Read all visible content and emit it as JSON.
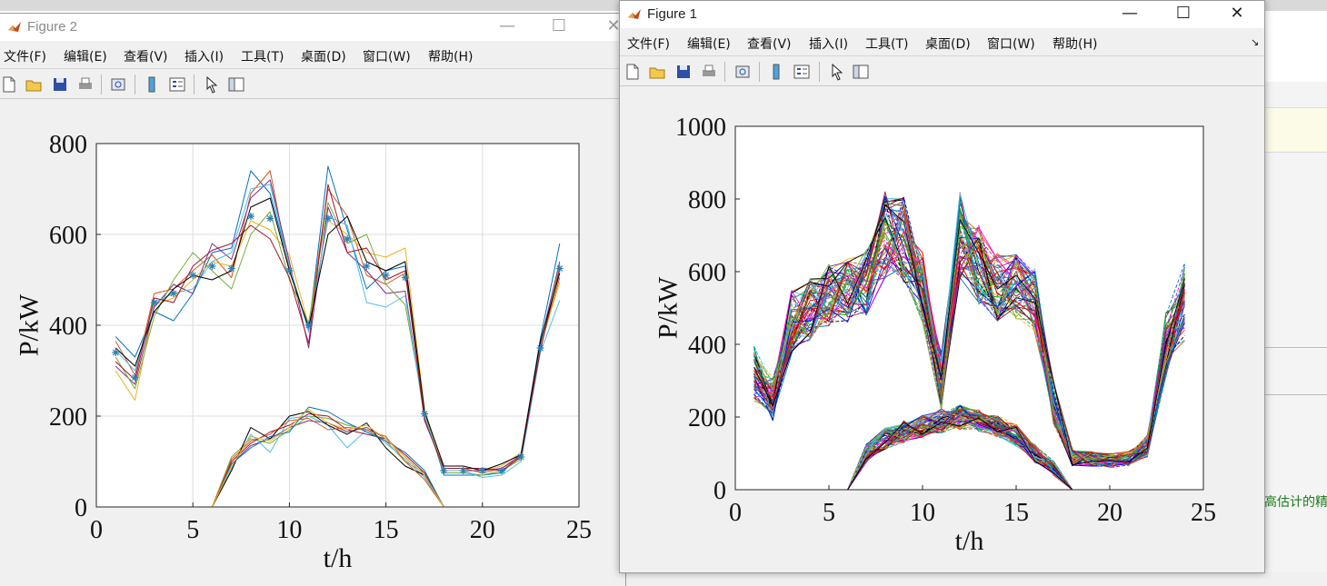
{
  "colors": {
    "series": [
      "#0072BD",
      "#D95319",
      "#EDB120",
      "#7E2F8E",
      "#77AC30",
      "#4DBEEE",
      "#A2142F",
      "#000000"
    ],
    "axes_bg": "#ffffff",
    "figure_bg": "#f0f0f0",
    "grid": "#dcdcdc"
  },
  "background": {
    "snippet": "高估计的精"
  },
  "windows": {
    "figure2": {
      "title": "Figure 2",
      "controls": {
        "minimize": "—",
        "maximize": "☐",
        "close": "✕"
      },
      "menu": [
        "文件(F)",
        "编辑(E)",
        "查看(V)",
        "插入(I)",
        "工具(T)",
        "桌面(D)",
        "窗口(W)",
        "帮助(H)"
      ],
      "toolbar_icons": [
        "new-file-icon",
        "open-folder-icon",
        "save-icon",
        "print-icon",
        "print-preview-icon",
        "colorbar-icon",
        "legend-icon",
        "pointer-icon",
        "property-inspector-icon"
      ]
    },
    "figure1": {
      "title": "Figure 1",
      "controls": {
        "minimize": "—",
        "maximize": "☐",
        "close": "✕",
        "dock": "↘"
      },
      "menu": [
        "文件(F)",
        "编辑(E)",
        "查看(V)",
        "插入(I)",
        "工具(T)",
        "桌面(D)",
        "窗口(W)",
        "帮助(H)"
      ],
      "toolbar_icons": [
        "new-file-icon",
        "open-folder-icon",
        "save-icon",
        "print-icon",
        "print-preview-icon",
        "colorbar-icon",
        "legend-icon",
        "pointer-icon",
        "property-inspector-icon"
      ]
    }
  },
  "chart_data": [
    {
      "figure": "Figure 2",
      "type": "line",
      "xlabel": "t/h",
      "ylabel": "P/kW",
      "xlim": [
        0,
        25
      ],
      "ylim": [
        0,
        800
      ],
      "xticks": [
        "0",
        "5",
        "10",
        "15",
        "20",
        "25"
      ],
      "yticks": [
        "0",
        "200",
        "400",
        "600",
        "800"
      ],
      "grid": true,
      "x": [
        1,
        2,
        3,
        4,
        5,
        6,
        7,
        8,
        9,
        10,
        11,
        12,
        13,
        14,
        15,
        16,
        17,
        18,
        19,
        20,
        21,
        22,
        23,
        24
      ],
      "load_mean": [
        340,
        285,
        450,
        470,
        510,
        530,
        525,
        640,
        635,
        520,
        400,
        635,
        590,
        530,
        510,
        505,
        205,
        80,
        80,
        80,
        80,
        110,
        350,
        525
      ],
      "load_scenarios": [
        [
          375,
          330,
          430,
          410,
          470,
          560,
          570,
          740,
          690,
          530,
          390,
          750,
          610,
          480,
          520,
          530,
          210,
          70,
          70,
          70,
          75,
          115,
          370,
          580
        ],
        [
          365,
          290,
          470,
          480,
          520,
          555,
          505,
          690,
          740,
          520,
          395,
          700,
          640,
          510,
          490,
          515,
          200,
          85,
          85,
          75,
          85,
          110,
          350,
          505
        ],
        [
          300,
          235,
          445,
          460,
          500,
          540,
          530,
          630,
          610,
          555,
          400,
          630,
          600,
          560,
          550,
          570,
          215,
          80,
          80,
          80,
          90,
          120,
          355,
          495
        ],
        [
          310,
          270,
          440,
          490,
          470,
          580,
          545,
          680,
          720,
          540,
          350,
          660,
          560,
          520,
          470,
          475,
          195,
          80,
          80,
          80,
          85,
          115,
          360,
          540
        ],
        [
          330,
          260,
          420,
          500,
          560,
          520,
          480,
          600,
          650,
          500,
          405,
          670,
          580,
          600,
          490,
          445,
          210,
          75,
          75,
          70,
          80,
          105,
          350,
          530
        ],
        [
          345,
          300,
          450,
          470,
          480,
          540,
          560,
          700,
          710,
          530,
          385,
          640,
          620,
          450,
          440,
          465,
          200,
          80,
          80,
          65,
          70,
          100,
          340,
          455
        ],
        [
          320,
          280,
          460,
          450,
          530,
          565,
          580,
          620,
          590,
          505,
          360,
          710,
          560,
          570,
          500,
          520,
          190,
          85,
          85,
          85,
          80,
          110,
          345,
          525
        ],
        [
          350,
          310,
          430,
          480,
          510,
          500,
          520,
          660,
          680,
          520,
          395,
          600,
          640,
          540,
          520,
          540,
          210,
          90,
          90,
          80,
          95,
          115,
          365,
          515
        ]
      ],
      "pv_scenarios": [
        [
          0,
          0,
          0,
          0,
          0,
          0,
          95,
          135,
          150,
          175,
          190,
          185,
          165,
          175,
          150,
          110,
          70,
          0,
          0,
          0,
          0,
          0,
          0,
          0
        ],
        [
          0,
          0,
          0,
          0,
          0,
          0,
          110,
          150,
          140,
          170,
          200,
          195,
          180,
          170,
          145,
          100,
          75,
          0,
          0,
          0,
          0,
          0,
          0,
          0
        ],
        [
          0,
          0,
          0,
          0,
          0,
          0,
          85,
          160,
          120,
          195,
          200,
          180,
          130,
          170,
          140,
          105,
          65,
          0,
          0,
          0,
          0,
          0,
          0,
          0
        ],
        [
          0,
          0,
          0,
          0,
          0,
          0,
          100,
          140,
          165,
          180,
          205,
          200,
          170,
          160,
          150,
          115,
          75,
          0,
          0,
          0,
          0,
          0,
          0,
          0
        ],
        [
          0,
          0,
          0,
          0,
          0,
          0,
          80,
          175,
          150,
          200,
          210,
          180,
          160,
          185,
          130,
          90,
          70,
          0,
          0,
          0,
          0,
          0,
          0,
          0
        ],
        [
          0,
          0,
          0,
          0,
          0,
          0,
          95,
          130,
          155,
          165,
          220,
          210,
          185,
          165,
          145,
          120,
          80,
          0,
          0,
          0,
          0,
          0,
          0,
          0
        ],
        [
          0,
          0,
          0,
          0,
          0,
          0,
          105,
          145,
          160,
          190,
          195,
          170,
          175,
          170,
          155,
          100,
          60,
          0,
          0,
          0,
          0,
          0,
          0,
          0
        ],
        [
          0,
          0,
          0,
          0,
          0,
          0,
          90,
          155,
          145,
          175,
          215,
          185,
          170,
          180,
          150,
          110,
          70,
          0,
          0,
          0,
          0,
          0,
          0,
          0
        ]
      ]
    },
    {
      "figure": "Figure 1",
      "type": "line",
      "xlabel": "t/h",
      "ylabel": "P/kW",
      "xlim": [
        0,
        25
      ],
      "ylim": [
        0,
        1000
      ],
      "xticks": [
        "0",
        "5",
        "10",
        "15",
        "20",
        "25"
      ],
      "yticks": [
        "0",
        "200",
        "400",
        "600",
        "800",
        "1000"
      ],
      "grid": false,
      "x": [
        1,
        2,
        3,
        4,
        5,
        6,
        7,
        8,
        9,
        10,
        11,
        12,
        13,
        14,
        15,
        16,
        17,
        18,
        19,
        20,
        21,
        22,
        23,
        24
      ],
      "scenario_count": 60,
      "load_band": {
        "mean": [
          320,
          250,
          460,
          500,
          540,
          550,
          570,
          700,
          690,
          560,
          300,
          700,
          620,
          560,
          560,
          520,
          240,
          90,
          85,
          80,
          85,
          120,
          400,
          520
        ],
        "spread": [
          80,
          60,
          90,
          90,
          90,
          90,
          90,
          120,
          120,
          100,
          80,
          120,
          110,
          100,
          90,
          90,
          60,
          25,
          20,
          20,
          20,
          30,
          90,
          110
        ]
      },
      "pv_band": {
        "mean": [
          0,
          0,
          0,
          0,
          0,
          0,
          100,
          140,
          160,
          175,
          190,
          200,
          190,
          175,
          150,
          100,
          60,
          0,
          0,
          0,
          0,
          0,
          0,
          0
        ],
        "spread": [
          0,
          0,
          0,
          0,
          0,
          0,
          25,
          30,
          30,
          30,
          35,
          35,
          30,
          30,
          30,
          25,
          20,
          0,
          0,
          0,
          0,
          0,
          0,
          0
        ]
      }
    }
  ]
}
